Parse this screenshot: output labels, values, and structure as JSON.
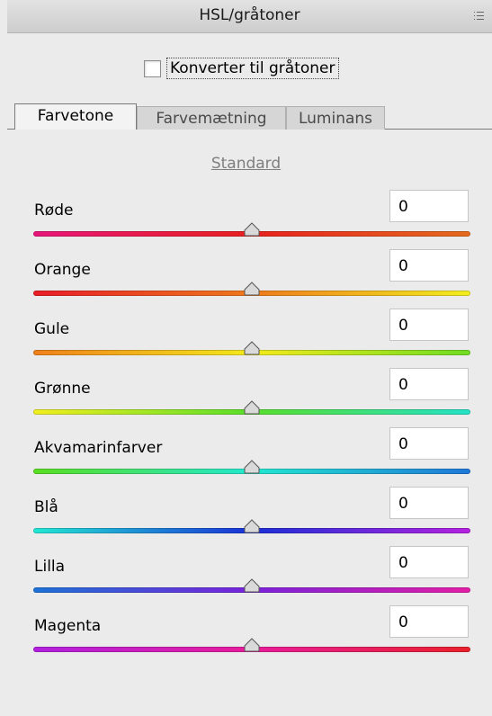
{
  "panel": {
    "title": "HSL/gråtoner",
    "menu_icon": "panel-menu-icon"
  },
  "grayscale": {
    "label": "Konverter til gråtoner",
    "checked": false
  },
  "tabs": [
    {
      "label": "Farvetone",
      "active": true
    },
    {
      "label": "Farvemætning",
      "active": false
    },
    {
      "label": "Luminans",
      "active": false
    }
  ],
  "default_link": "Standard",
  "sliders": [
    {
      "label": "Røde",
      "value": "0",
      "gradient": [
        "#e8157a",
        "#e8211e",
        "#e46a1e"
      ]
    },
    {
      "label": "Orange",
      "value": "0",
      "gradient": [
        "#e81c28",
        "#ee7a1c",
        "#f2ee1e"
      ]
    },
    {
      "label": "Gule",
      "value": "0",
      "gradient": [
        "#f0801c",
        "#f3ea1c",
        "#6fdc22"
      ]
    },
    {
      "label": "Grønne",
      "value": "0",
      "gradient": [
        "#f2ee1e",
        "#58de2a",
        "#23e2c8"
      ]
    },
    {
      "label": "Akvamarinfarver",
      "value": "0",
      "gradient": [
        "#5ade20",
        "#22e8d0",
        "#1f77d8"
      ]
    },
    {
      "label": "Blå",
      "value": "0",
      "gradient": [
        "#22e8d4",
        "#1a2fd6",
        "#b521e0"
      ]
    },
    {
      "label": "Lilla",
      "value": "0",
      "gradient": [
        "#1c72d6",
        "#7a22dc",
        "#e41ea6"
      ]
    },
    {
      "label": "Magenta",
      "value": "0",
      "gradient": [
        "#b020e0",
        "#e81c9a",
        "#e8202a"
      ]
    }
  ]
}
